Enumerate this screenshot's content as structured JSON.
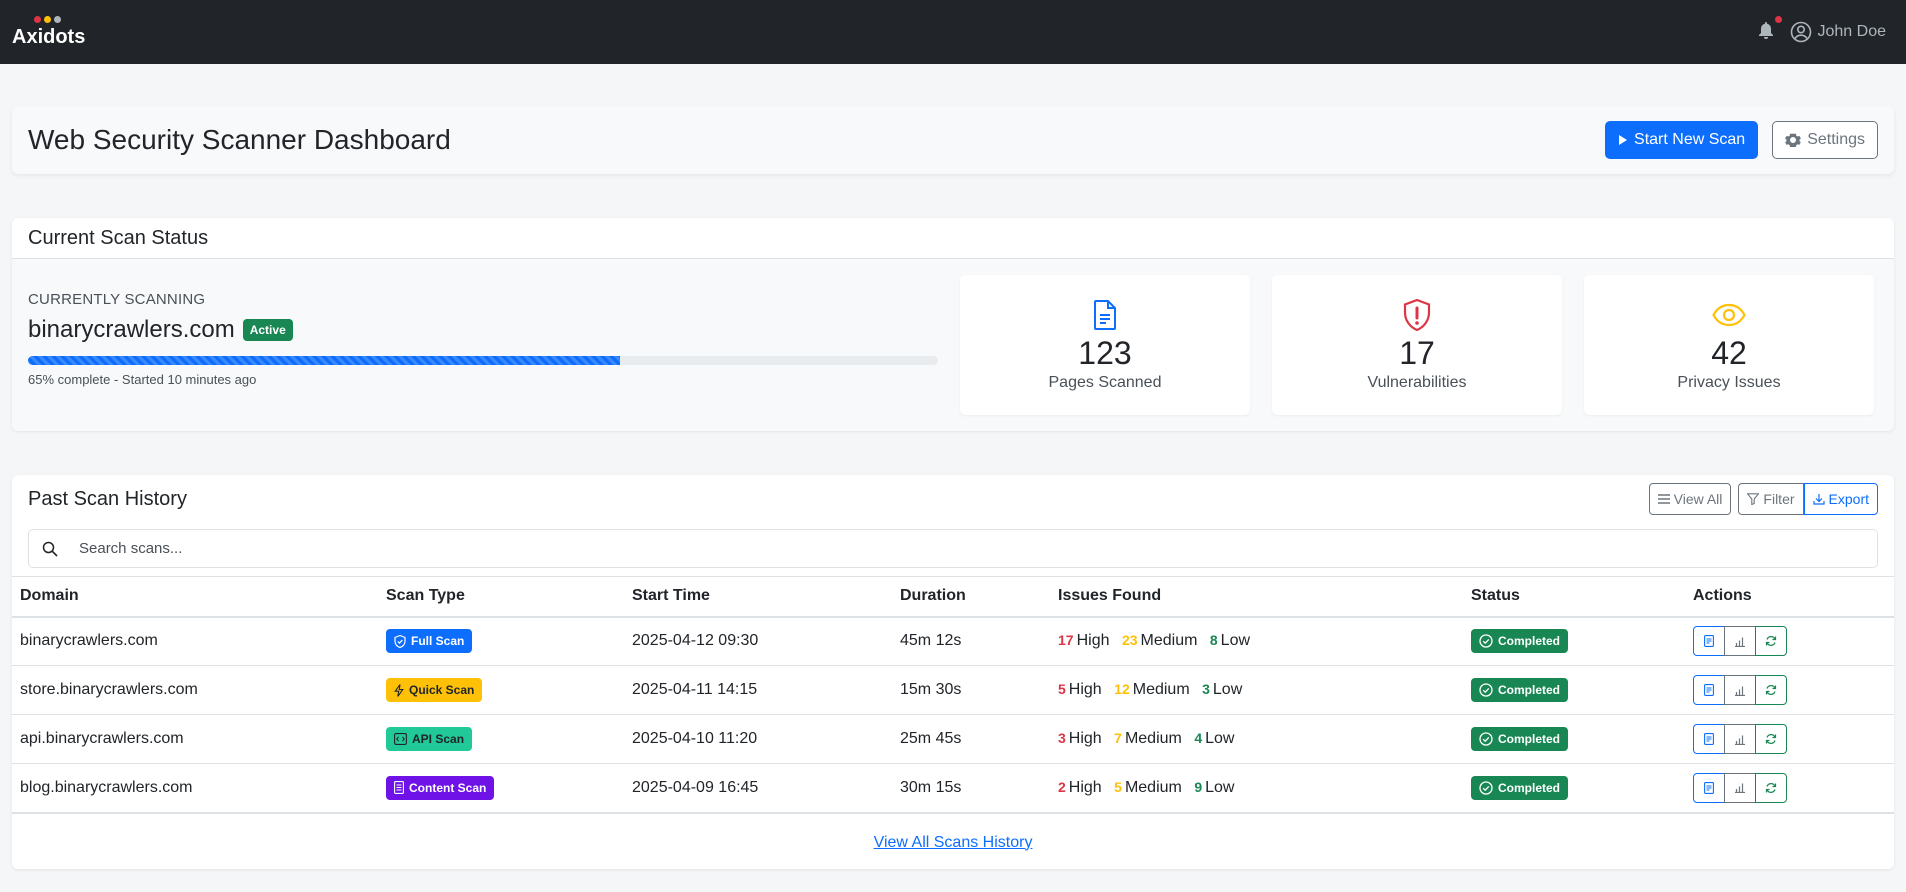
{
  "navbar": {
    "brand": "Axidots",
    "brand_dot_colors": [
      "#dc3545",
      "#ffc107",
      "#adb5bd"
    ],
    "user_name": "John Doe"
  },
  "header": {
    "title": "Web Security Scanner Dashboard",
    "start_scan_label": "Start New Scan",
    "settings_label": "Settings"
  },
  "current_scan": {
    "title": "Current Scan Status",
    "label": "CURRENTLY SCANNING",
    "domain": "binarycrawlers.com",
    "status_badge": "Active",
    "progress_percent": 65,
    "progress_text": "65% complete - Started 10 minutes ago",
    "stats": [
      {
        "icon": "document-icon",
        "value": "123",
        "label": "Pages Scanned",
        "color": "#0d6efd"
      },
      {
        "icon": "shield-alert-icon",
        "value": "17",
        "label": "Vulnerabilities",
        "color": "#dc3545"
      },
      {
        "icon": "eye-icon",
        "value": "42",
        "label": "Privacy Issues",
        "color": "#ffc107"
      }
    ]
  },
  "history": {
    "title": "Past Scan History",
    "view_all_label": "View All",
    "filter_label": "Filter",
    "export_label": "Export",
    "search_placeholder": "Search scans...",
    "columns": [
      "Domain",
      "Scan Type",
      "Start Time",
      "Duration",
      "Issues Found",
      "Status",
      "Actions"
    ],
    "rows": [
      {
        "domain": "binarycrawlers.com",
        "type": "Full Scan",
        "type_color": "#0d6efd",
        "type_text_color": "#ffffff",
        "start": "2025-04-12 09:30",
        "duration": "45m 12s",
        "high": "17",
        "medium": "23",
        "low": "8",
        "status": "Completed"
      },
      {
        "domain": "store.binarycrawlers.com",
        "type": "Quick Scan",
        "type_color": "#ffc107",
        "type_text_color": "#212529",
        "start": "2025-04-11 14:15",
        "duration": "15m 30s",
        "high": "5",
        "medium": "12",
        "low": "3",
        "status": "Completed"
      },
      {
        "domain": "api.binarycrawlers.com",
        "type": "API Scan",
        "type_color": "#20c997",
        "type_text_color": "#212529",
        "start": "2025-04-10 11:20",
        "duration": "25m 45s",
        "high": "3",
        "medium": "7",
        "low": "4",
        "status": "Completed"
      },
      {
        "domain": "blog.binarycrawlers.com",
        "type": "Content Scan",
        "type_color": "#6f12e8",
        "type_text_color": "#ffffff",
        "start": "2025-04-09 16:45",
        "duration": "30m 15s",
        "high": "2",
        "medium": "5",
        "low": "9",
        "status": "Completed"
      }
    ],
    "severity_labels": {
      "high": "High",
      "medium": "Medium",
      "low": "Low"
    },
    "severity_colors": {
      "high": "#dc3545",
      "medium": "#ffc107",
      "low": "#198754"
    },
    "footer_link": "View All Scans History"
  }
}
